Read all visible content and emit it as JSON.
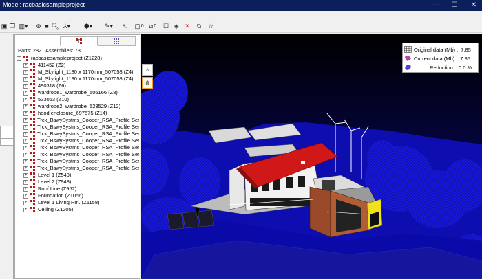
{
  "window": {
    "title": "Model: racbasicsampleproject",
    "minimize_glyph": "—",
    "maximize_glyph": "☐",
    "close_glyph": "✕"
  },
  "toolbar": {
    "section_box_count": "0",
    "section_plane_count": "0"
  },
  "tree_panel": {
    "parts_label": "Parts:",
    "parts_value": "282",
    "assemblies_label": "Assemblies:",
    "assemblies_value": "73",
    "root": "racbasicsampleproject  (Z1228)",
    "items": [
      "411452  (Z2)",
      "M_Skylight_1180 x 1170mm_507058  (Z4)",
      "M_Skylight_1180 x 1170mm_507058  (Z4)",
      "490318  (Z6)",
      "wardrobe1_wardrobe_506166  (Z8)",
      "523063  (Z10)",
      "wardrobe2_wardrobe_523529  (Z12)",
      "hood enclosure_697575  (Z14)",
      "Trck_BswySystms_Cooper_RSA_Profile Series",
      "Trck_BswySystms_Cooper_RSA_Profile Series",
      "Trck_BswySystms_Cooper_RSA_Profile Series",
      "Trck_BswySystms_Cooper_RSA_Profile Series",
      "Trck_BswySystms_Cooper_RSA_Profile Series",
      "Trck_BswySystms_Cooper_RSA_Profile Series",
      "Trck_BswySystms_Cooper_RSA_Profile Series",
      "Trck_BswySystms_Cooper_RSA_Profile Series",
      "Level 1  (Z549)",
      "Level 2  (Z948)",
      "Roof Line  (Z952)",
      "Foundation  (Z1056)",
      "Level 1 Living Rm.  (Z1158)",
      "Ceiling  (Z1205)"
    ]
  },
  "data_panel": {
    "original_label": "Original data (Mb) :",
    "original_value": "7.85",
    "current_label": "Current data (Mb) :",
    "current_value": "7.85",
    "reduction_label": "Reduction :",
    "reduction_value": "0.0 %"
  },
  "colors": {
    "titlebar": "#0a1f5c",
    "viewport_blue": "#1414d8",
    "roof_red": "#d01818",
    "accent_yellow": "#f2e21a",
    "wall_brown": "#9a4a2a"
  }
}
